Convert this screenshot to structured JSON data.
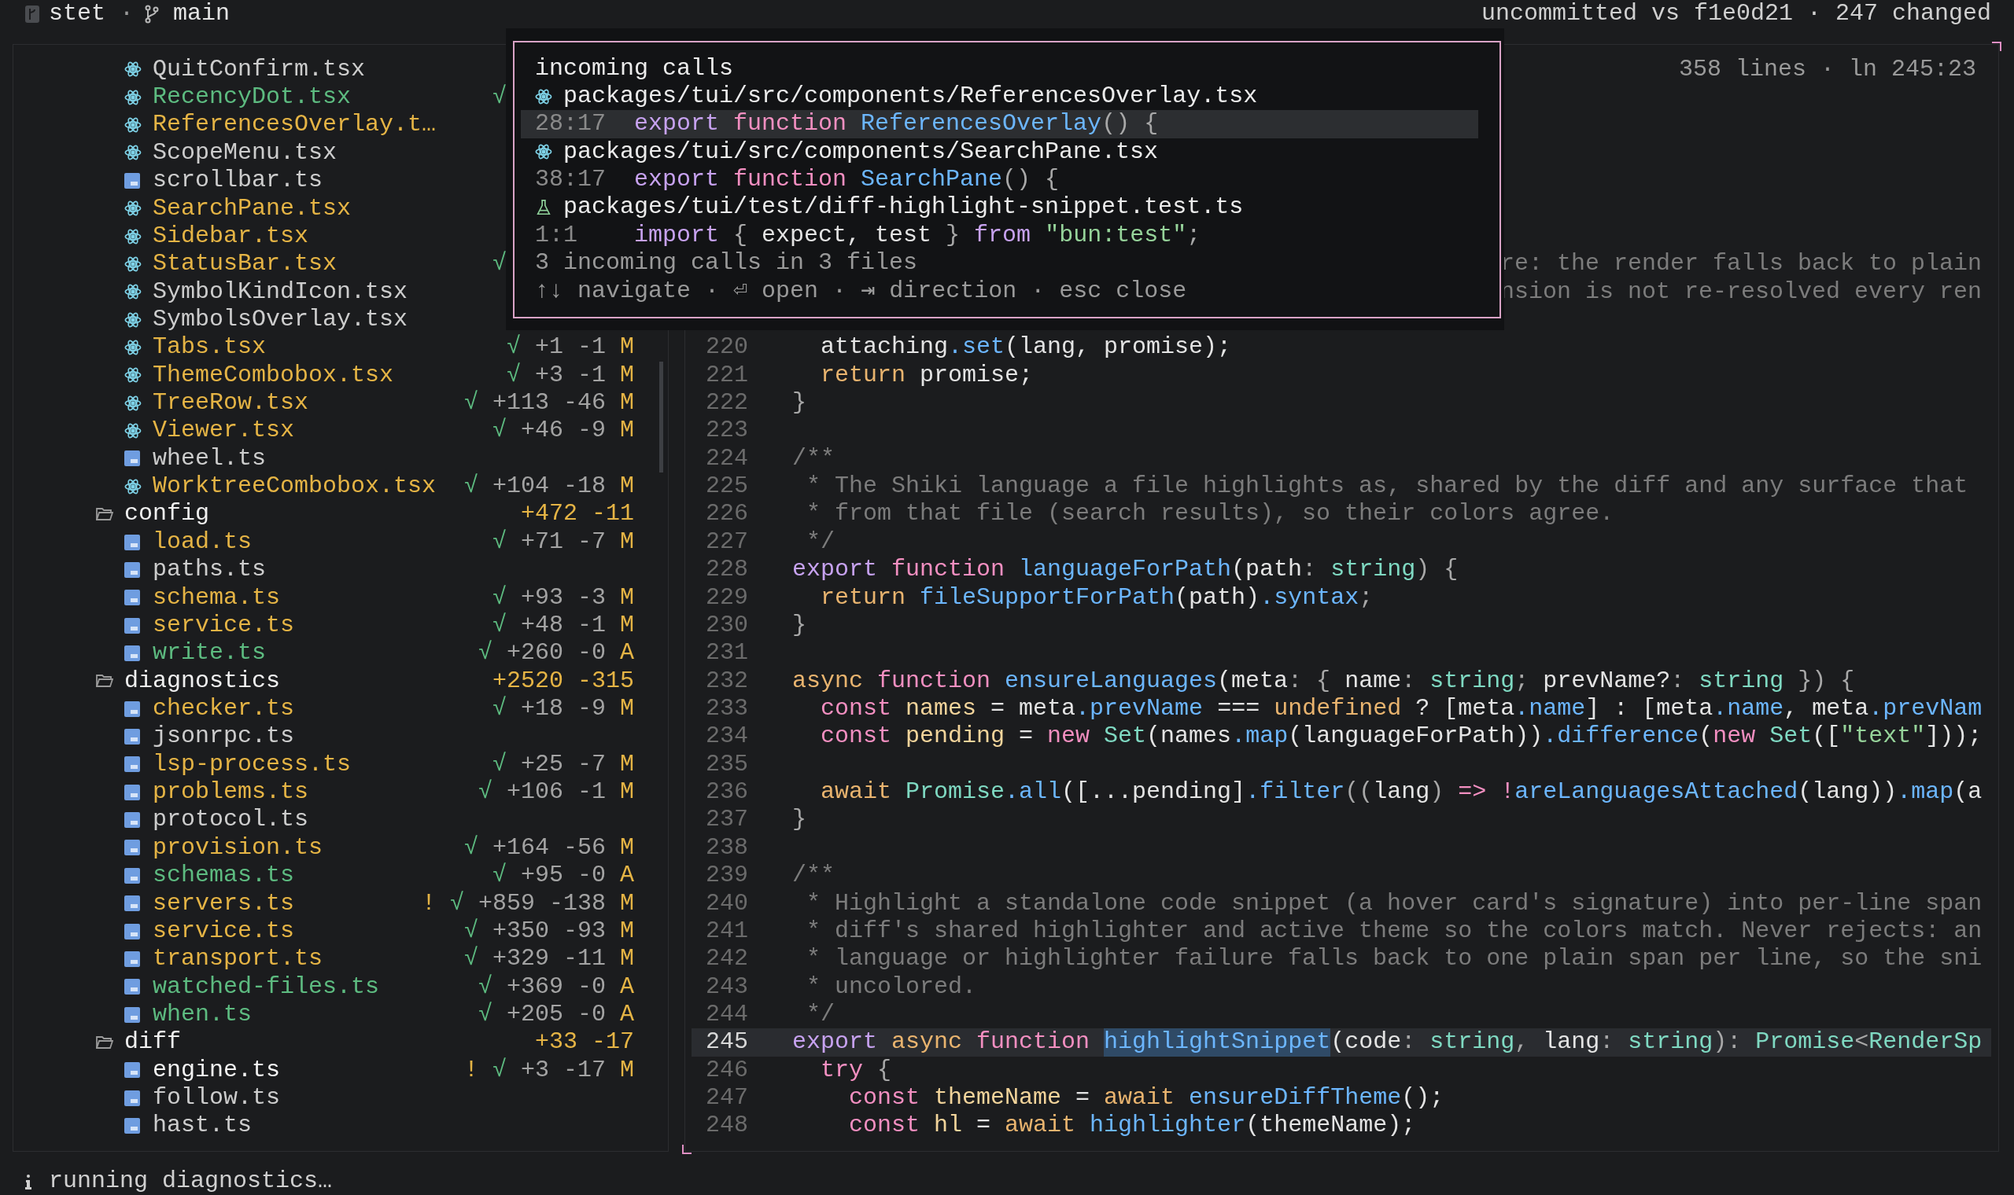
{
  "top_bar": {
    "repo": "stet",
    "separator": "·",
    "branch": "main",
    "summary": "uncommitted vs f1e0d21 · 247 changed"
  },
  "tree": [
    {
      "kind": "continued",
      "children": [
        {
          "kind": "react_file",
          "name": "QuitConfirm.tsx",
          "color": "#cdcdcd"
        },
        {
          "kind": "react_file",
          "name": "RecencyDot.tsx",
          "color": "#5dbb80",
          "check": "√"
        },
        {
          "kind": "react_file",
          "name": "ReferencesOverlay.t…",
          "color": "#e5b445"
        },
        {
          "kind": "react_file",
          "name": "ScopeMenu.tsx",
          "color": "#cdcdcd"
        },
        {
          "kind": "ts_file",
          "name": "scrollbar.ts",
          "color": "#cdcdcd"
        },
        {
          "kind": "react_file",
          "name": "SearchPane.tsx",
          "color": "#e5b445"
        },
        {
          "kind": "react_file",
          "name": "Sidebar.tsx",
          "color": "#e5b445"
        },
        {
          "kind": "react_file",
          "name": "StatusBar.tsx",
          "color": "#e5b445",
          "check": "√"
        },
        {
          "kind": "react_file",
          "name": "SymbolKindIcon.tsx",
          "color": "#cdcdcd"
        },
        {
          "kind": "react_file",
          "name": "SymbolsOverlay.tsx",
          "color": "#cdcdcd"
        },
        {
          "kind": "react_file",
          "name": "Tabs.tsx",
          "color": "#e5b445",
          "check": "√",
          "added": "+1",
          "removed": "-1",
          "badge": "M"
        },
        {
          "kind": "react_file",
          "name": "ThemeCombobox.tsx",
          "color": "#e5b445",
          "check": "√",
          "added": "+3",
          "removed": "-1",
          "badge": "M"
        },
        {
          "kind": "react_file",
          "name": "TreeRow.tsx",
          "color": "#e5b445",
          "check": "√",
          "added": "+113",
          "removed": "-46",
          "badge": "M"
        },
        {
          "kind": "react_file",
          "name": "Viewer.tsx",
          "color": "#e5b445",
          "check": "√",
          "added": "+46",
          "removed": "-9",
          "badge": "M"
        },
        {
          "kind": "ts_file",
          "name": "wheel.ts",
          "color": "#cdcdcd"
        },
        {
          "kind": "react_file",
          "name": "WorktreeCombobox.tsx",
          "color": "#e5b445",
          "check": "√",
          "added": "+104",
          "removed": "-18",
          "badge": "M"
        }
      ]
    },
    {
      "kind": "folder",
      "name": "config",
      "expanded": true,
      "added": "+472",
      "removed": "-11",
      "children": [
        {
          "kind": "ts_file",
          "name": "load.ts",
          "color": "#e5b445",
          "check": "√",
          "added": "+71",
          "removed": "-7",
          "badge": "M"
        },
        {
          "kind": "ts_file",
          "name": "paths.ts",
          "color": "#cdcdcd"
        },
        {
          "kind": "ts_file",
          "name": "schema.ts",
          "color": "#e5b445",
          "check": "√",
          "added": "+93",
          "removed": "-3",
          "badge": "M"
        },
        {
          "kind": "ts_file",
          "name": "service.ts",
          "color": "#e5b445",
          "check": "√",
          "added": "+48",
          "removed": "-1",
          "badge": "M"
        },
        {
          "kind": "ts_file",
          "name": "write.ts",
          "color": "#5dbb80",
          "check": "√",
          "added": "+260",
          "removed": "-0",
          "badge": "A"
        }
      ]
    },
    {
      "kind": "folder",
      "name": "diagnostics",
      "expanded": true,
      "added": "+2520",
      "removed": "-315",
      "children": [
        {
          "kind": "ts_file",
          "name": "checker.ts",
          "color": "#e5b445",
          "check": "√",
          "added": "+18",
          "removed": "-9",
          "badge": "M"
        },
        {
          "kind": "ts_file",
          "name": "jsonrpc.ts",
          "color": "#cdcdcd"
        },
        {
          "kind": "ts_file",
          "name": "lsp-process.ts",
          "color": "#e5b445",
          "check": "√",
          "added": "+25",
          "removed": "-7",
          "badge": "M"
        },
        {
          "kind": "ts_file",
          "name": "problems.ts",
          "color": "#e5b445",
          "check": "√",
          "added": "+106",
          "removed": "-1",
          "badge": "M"
        },
        {
          "kind": "ts_file",
          "name": "protocol.ts",
          "color": "#cdcdcd"
        },
        {
          "kind": "ts_file",
          "name": "provision.ts",
          "color": "#e5b445",
          "check": "√",
          "added": "+164",
          "removed": "-56",
          "badge": "M"
        },
        {
          "kind": "ts_file",
          "name": "schemas.ts",
          "color": "#5dbb80",
          "check": "√",
          "added": "+95",
          "removed": "-0",
          "badge": "A"
        },
        {
          "kind": "ts_file",
          "name": "servers.ts",
          "color": "#e5b445",
          "warning": "!",
          "check": "√",
          "added": "+859",
          "removed": "-138",
          "badge": "M"
        },
        {
          "kind": "ts_file",
          "name": "service.ts",
          "color": "#e5b445",
          "check": "√",
          "added": "+350",
          "removed": "-93",
          "badge": "M"
        },
        {
          "kind": "ts_file",
          "name": "transport.ts",
          "color": "#e5b445",
          "check": "√",
          "added": "+329",
          "removed": "-11",
          "badge": "M"
        },
        {
          "kind": "ts_file",
          "name": "watched-files.ts",
          "color": "#5dbb80",
          "check": "√",
          "added": "+369",
          "removed": "-0",
          "badge": "A"
        },
        {
          "kind": "ts_file",
          "name": "when.ts",
          "color": "#5dbb80",
          "check": "√",
          "added": "+205",
          "removed": "-0",
          "badge": "A"
        }
      ]
    },
    {
      "kind": "folder",
      "name": "diff",
      "expanded": true,
      "added": "+33",
      "removed": "-17",
      "children": [
        {
          "kind": "ts_file",
          "name": "engine.ts",
          "color": "#f4f4f4",
          "warning": "!",
          "check": "√",
          "added": "+3",
          "removed": "-17",
          "badge": "M"
        },
        {
          "kind": "ts_file",
          "name": "follow.ts",
          "color": "#cdcdcd"
        },
        {
          "kind": "ts_file",
          "name": "hast.ts",
          "color": "#cdcdcd"
        }
      ]
    }
  ],
  "editor": {
    "header": "358 lines · ln 245:23",
    "fragments": [
      "re: the render falls back to plain",
      "nsion is not re-resolved every ren"
    ],
    "lines": [
      {
        "number": "220",
        "selected": false,
        "tokens": [
          {
            "kind": "tx",
            "text": "  attaching"
          },
          {
            "kind": "pr",
            "text": ".set"
          },
          {
            "kind": "tx",
            "text": "(lang, promise);"
          }
        ]
      },
      {
        "number": "221",
        "selected": false,
        "tokens": [
          {
            "kind": "mod",
            "text": "  return"
          },
          {
            "kind": "tx",
            "text": " promise;"
          }
        ]
      },
      {
        "number": "222",
        "selected": false,
        "tokens": [
          {
            "kind": "pu",
            "text": "}"
          }
        ]
      },
      {
        "number": "223",
        "selected": false
      },
      {
        "number": "224",
        "selected": false,
        "tokens": [
          {
            "kind": "cm",
            "text": "/**"
          }
        ]
      },
      {
        "number": "225",
        "selected": false,
        "tokens": [
          {
            "kind": "cm",
            "text": " * The Shiki language a file highlights as, shared by the diff and any surface that"
          }
        ]
      },
      {
        "number": "226",
        "selected": false,
        "tokens": [
          {
            "kind": "cm",
            "text": " * from that file (search results), so their colors agree."
          }
        ]
      },
      {
        "number": "227",
        "selected": false,
        "tokens": [
          {
            "kind": "cm",
            "text": " */"
          }
        ]
      },
      {
        "number": "228",
        "selected": false,
        "tokens": [
          {
            "kind": "kw",
            "text": "export"
          },
          {
            "kind": "ctl",
            "text": " function"
          },
          {
            "kind": "fn",
            "text": " languageForPath"
          },
          {
            "kind": "tx",
            "text": "(path"
          },
          {
            "kind": "pu",
            "text": ":"
          },
          {
            "kind": "ty",
            "text": " string"
          },
          {
            "kind": "pu",
            "text": ") {"
          }
        ]
      },
      {
        "number": "229",
        "selected": false,
        "tokens": [
          {
            "kind": "mod",
            "text": "  return"
          },
          {
            "kind": "fn",
            "text": " fileSupportForPath"
          },
          {
            "kind": "tx",
            "text": "(path)"
          },
          {
            "kind": "pr",
            "text": ".syntax"
          },
          {
            "kind": "pu",
            "text": ";"
          }
        ]
      },
      {
        "number": "230",
        "selected": false,
        "tokens": [
          {
            "kind": "pu",
            "text": "}"
          }
        ]
      },
      {
        "number": "231",
        "selected": false
      },
      {
        "number": "232",
        "selected": false,
        "tokens": [
          {
            "kind": "mod",
            "text": "async"
          },
          {
            "kind": "ctl",
            "text": " function"
          },
          {
            "kind": "fn",
            "text": " ensureLanguages"
          },
          {
            "kind": "tx",
            "text": "(meta"
          },
          {
            "kind": "pu",
            "text": ": {"
          },
          {
            "kind": "tx",
            "text": " name"
          },
          {
            "kind": "pu",
            "text": ":"
          },
          {
            "kind": "ty",
            "text": " string"
          },
          {
            "kind": "pu",
            "text": ";"
          },
          {
            "kind": "tx",
            "text": " prevName?"
          },
          {
            "kind": "pu",
            "text": ":"
          },
          {
            "kind": "ty",
            "text": " string"
          },
          {
            "kind": "pu",
            "text": " }) {"
          }
        ]
      },
      {
        "number": "233",
        "selected": false,
        "tokens": [
          {
            "kind": "ctl",
            "text": "  const"
          },
          {
            "kind": "va",
            "text": " names"
          },
          {
            "kind": "tx",
            "text": " = meta"
          },
          {
            "kind": "pr",
            "text": ".prevName"
          },
          {
            "kind": "tx",
            "text": " ==="
          },
          {
            "kind": "mod",
            "text": " undefined"
          },
          {
            "kind": "tx",
            "text": " ? [meta"
          },
          {
            "kind": "pr",
            "text": ".name"
          },
          {
            "kind": "tx",
            "text": "] : [meta"
          },
          {
            "kind": "pr",
            "text": ".name"
          },
          {
            "kind": "tx",
            "text": ", meta"
          },
          {
            "kind": "pr",
            "text": ".prevNam"
          }
        ]
      },
      {
        "number": "234",
        "selected": false,
        "tokens": [
          {
            "kind": "ctl",
            "text": "  const"
          },
          {
            "kind": "va",
            "text": " pending"
          },
          {
            "kind": "tx",
            "text": " ="
          },
          {
            "kind": "ctl",
            "text": " new"
          },
          {
            "kind": "ty",
            "text": " Set"
          },
          {
            "kind": "tx",
            "text": "(names"
          },
          {
            "kind": "pr",
            "text": ".map"
          },
          {
            "kind": "tx",
            "text": "(languageForPath))"
          },
          {
            "kind": "pr",
            "text": ".difference"
          },
          {
            "kind": "tx",
            "text": "("
          },
          {
            "kind": "ctl",
            "text": "new"
          },
          {
            "kind": "ty",
            "text": " Set"
          },
          {
            "kind": "tx",
            "text": "(["
          },
          {
            "kind": "st",
            "text": "\"text\""
          },
          {
            "kind": "tx",
            "text": "]));"
          }
        ]
      },
      {
        "number": "235",
        "selected": false
      },
      {
        "number": "236",
        "selected": false,
        "tokens": [
          {
            "kind": "mod",
            "text": "  await"
          },
          {
            "kind": "ty",
            "text": " Promise"
          },
          {
            "kind": "pr",
            "text": ".all"
          },
          {
            "kind": "tx",
            "text": "([...pending]"
          },
          {
            "kind": "pr",
            "text": ".filter"
          },
          {
            "kind": "pu",
            "text": "(("
          },
          {
            "kind": "tx",
            "text": "lang"
          },
          {
            "kind": "pu",
            "text": ")"
          },
          {
            "kind": "ctl",
            "text": " => !"
          },
          {
            "kind": "fn",
            "text": "areLanguagesAttached"
          },
          {
            "kind": "tx",
            "text": "(lang))"
          },
          {
            "kind": "pr",
            "text": ".map"
          },
          {
            "kind": "tx",
            "text": "(a"
          }
        ]
      },
      {
        "number": "237",
        "selected": false,
        "tokens": [
          {
            "kind": "pu",
            "text": "}"
          }
        ]
      },
      {
        "number": "238",
        "selected": false
      },
      {
        "number": "239",
        "selected": false,
        "tokens": [
          {
            "kind": "cm",
            "text": "/**"
          }
        ]
      },
      {
        "number": "240",
        "selected": false,
        "tokens": [
          {
            "kind": "cm",
            "text": " * Highlight a standalone code snippet (a hover card's signature) into per-line span"
          }
        ]
      },
      {
        "number": "241",
        "selected": false,
        "tokens": [
          {
            "kind": "cm",
            "text": " * diff's shared highlighter and active theme so the colors match. Never rejects: an"
          }
        ]
      },
      {
        "number": "242",
        "selected": false,
        "tokens": [
          {
            "kind": "cm",
            "text": " * language or highlighter failure falls back to one plain span per line, so the sni"
          }
        ]
      },
      {
        "number": "243",
        "selected": false,
        "tokens": [
          {
            "kind": "cm",
            "text": " * uncolored."
          }
        ]
      },
      {
        "number": "244",
        "selected": false,
        "tokens": [
          {
            "kind": "cm",
            "text": " */"
          }
        ]
      },
      {
        "number": "245",
        "selected": true,
        "tokens": [
          {
            "kind": "kw",
            "text": "export"
          },
          {
            "kind": "mod",
            "text": " async"
          },
          {
            "kind": "ctl",
            "text": " function "
          },
          {
            "kind": "sel",
            "text": "highlightSnippet"
          },
          {
            "kind": "tx",
            "text": "(code"
          },
          {
            "kind": "pu",
            "text": ":"
          },
          {
            "kind": "ty",
            "text": " string"
          },
          {
            "kind": "pu",
            "text": ","
          },
          {
            "kind": "tx",
            "text": " lang"
          },
          {
            "kind": "pu",
            "text": ":"
          },
          {
            "kind": "ty",
            "text": " string"
          },
          {
            "kind": "pu",
            "text": "):"
          },
          {
            "kind": "ty",
            "text": " Promise"
          },
          {
            "kind": "pu",
            "text": "<"
          },
          {
            "kind": "ty",
            "text": "RenderSp"
          }
        ]
      },
      {
        "number": "246",
        "selected": false,
        "tokens": [
          {
            "kind": "ctl",
            "text": "  try"
          },
          {
            "kind": "pu",
            "text": " {"
          }
        ]
      },
      {
        "number": "247",
        "selected": false,
        "tokens": [
          {
            "kind": "ctl",
            "text": "    const"
          },
          {
            "kind": "va",
            "text": " themeName"
          },
          {
            "kind": "tx",
            "text": " ="
          },
          {
            "kind": "mod",
            "text": " await"
          },
          {
            "kind": "fn",
            "text": " ensureDiffTheme"
          },
          {
            "kind": "tx",
            "text": "();"
          }
        ]
      },
      {
        "number": "248",
        "selected": false,
        "tokens": [
          {
            "kind": "ctl",
            "text": "    const"
          },
          {
            "kind": "va",
            "text": " hl"
          },
          {
            "kind": "tx",
            "text": " ="
          },
          {
            "kind": "mod",
            "text": " await"
          },
          {
            "kind": "fn",
            "text": " highlighter"
          },
          {
            "kind": "tx",
            "text": "(themeName);"
          }
        ]
      }
    ]
  },
  "popup": {
    "title": "incoming calls",
    "items": [
      {
        "kind": "react_file",
        "selected": false,
        "path": "packages/tui/src/components/ReferencesOverlay.tsx"
      },
      {
        "kind": "call",
        "selected": true,
        "location": "28:17",
        "tokens": [
          {
            "kind": "kw",
            "text": "export"
          },
          {
            "kind": "ctl",
            "text": " function"
          },
          {
            "kind": "fn",
            "text": " ReferencesOverlay"
          },
          {
            "kind": "pu",
            "text": "() {"
          }
        ]
      },
      {
        "kind": "react_file",
        "selected": false,
        "path": "packages/tui/src/components/SearchPane.tsx"
      },
      {
        "kind": "call",
        "selected": false,
        "location": "38:17",
        "tokens": [
          {
            "kind": "kw",
            "text": "export"
          },
          {
            "kind": "ctl",
            "text": " function"
          },
          {
            "kind": "fn",
            "text": " SearchPane"
          },
          {
            "kind": "pu",
            "text": "() {"
          }
        ]
      },
      {
        "kind": "test_file",
        "selected": false,
        "path": "packages/tui/test/diff-highlight-snippet.test.ts"
      },
      {
        "kind": "call",
        "selected": false,
        "location": "1:1",
        "tokens": [
          {
            "kind": "kw",
            "text": "import"
          },
          {
            "kind": "pu",
            "text": " {"
          },
          {
            "kind": "tx",
            "text": " expect, test"
          },
          {
            "kind": "pu",
            "text": " }"
          },
          {
            "kind": "kw",
            "text": " from"
          },
          {
            "kind": "st",
            "text": " \"bun:test\""
          },
          {
            "kind": "pu",
            "text": ";"
          }
        ]
      }
    ],
    "summary": "3 incoming calls in 3 files",
    "hints": "↑↓ navigate · ⏎ open · ⇥ direction · esc close"
  },
  "status_bar": {
    "text": "running diagnostics…"
  }
}
